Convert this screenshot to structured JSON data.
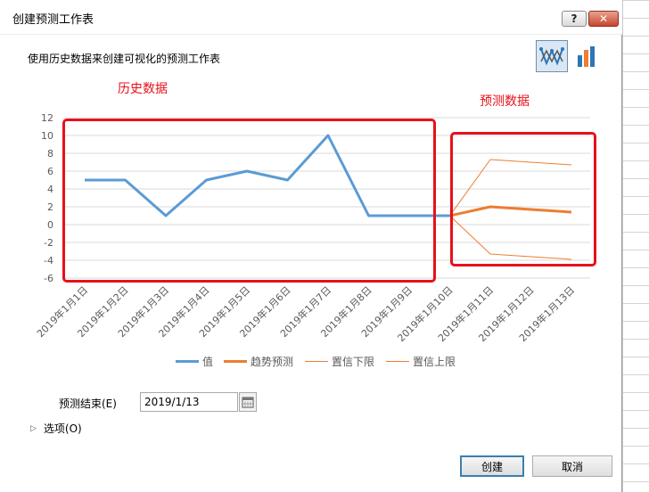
{
  "window": {
    "title": "创建预测工作表",
    "help_label": "?",
    "close_label": "✕"
  },
  "description": "使用历史数据来创建可视化的预测工作表",
  "chart_type_buttons": [
    {
      "name": "line-chart-icon",
      "selected": true
    },
    {
      "name": "column-chart-icon",
      "selected": false
    }
  ],
  "annotations": {
    "history": "历史数据",
    "forecast": "预测数据",
    "color": "#e8101a"
  },
  "chart_data": {
    "type": "line",
    "categories": [
      "2019年1月1日",
      "2019年1月2日",
      "2019年1月3日",
      "2019年1月4日",
      "2019年1月5日",
      "2019年1月6日",
      "2019年1月7日",
      "2019年1月8日",
      "2019年1月9日",
      "2019年1月10日",
      "2019年1月11日",
      "2019年1月12日",
      "2019年1月13日"
    ],
    "ylim": [
      -6,
      12
    ],
    "yticks": [
      "12",
      "10",
      "8",
      "6",
      "4",
      "2",
      "0",
      "-2",
      "-4",
      "-6"
    ],
    "grid": true,
    "legend_position": "bottom",
    "series": [
      {
        "name": "值",
        "color": "#5b9bd5",
        "values": [
          5,
          5,
          1,
          5,
          6,
          5,
          10,
          1,
          1,
          1,
          null,
          null,
          null
        ]
      },
      {
        "name": "趋势预测",
        "color": "#ed7d31",
        "values": [
          null,
          null,
          null,
          null,
          null,
          null,
          null,
          null,
          null,
          1,
          2,
          1.7,
          1.4
        ]
      },
      {
        "name": "置信下限",
        "color": "#ed7d31",
        "values": [
          null,
          null,
          null,
          null,
          null,
          null,
          null,
          null,
          null,
          1,
          -3.3,
          -3.6,
          -3.9
        ]
      },
      {
        "name": "置信上限",
        "color": "#ed7d31",
        "values": [
          null,
          null,
          null,
          null,
          null,
          null,
          null,
          null,
          null,
          1,
          7.3,
          7.0,
          6.7
        ]
      }
    ]
  },
  "forecast_end": {
    "label": "预测结束(E)",
    "value": "2019/1/13"
  },
  "options_label": "选项(O)",
  "buttons": {
    "create": "创建",
    "cancel": "取消"
  }
}
